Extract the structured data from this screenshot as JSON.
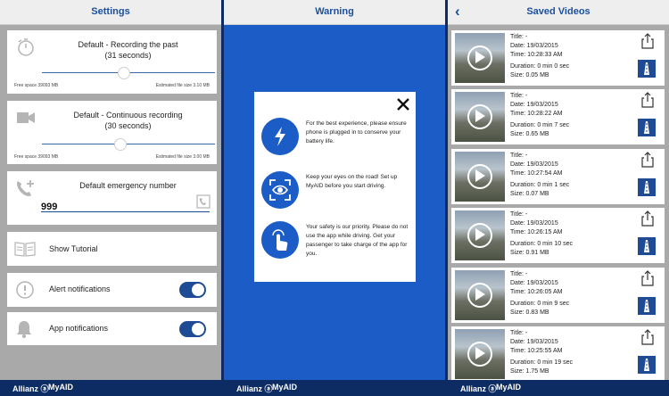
{
  "settings": {
    "title": "Settings",
    "recording_past": {
      "title": "Default - Recording the past",
      "sub": "(31 seconds)",
      "free": "Free space 39093 MB",
      "size": "Estimated file size 3.10 MB",
      "level": 0.47
    },
    "continuous": {
      "title": "Default - Continuous recording",
      "sub": "(30 seconds)",
      "free": "Free space 39093 MB",
      "size": "Estimated file size 3.00 MB",
      "level": 0.45
    },
    "emergency": {
      "title": "Default emergency number",
      "value": "999"
    },
    "tutorial": "Show Tutorial",
    "alert": "Alert notifications",
    "app": "App notifications"
  },
  "warning": {
    "title": "Warning",
    "items": [
      "For the best experience, please ensure phone is plugged in to conserve your battery life.",
      "Keep your eyes on the road! Set up MyAID before you start driving.",
      "Your safety is our priority. Please do not use the app while driving. Get your passenger to take charge of the app for you."
    ]
  },
  "videos": {
    "title": "Saved Videos",
    "list": [
      {
        "title": "Title:  -",
        "date": "Date: 19/03/2015",
        "time": "Time: 10:28:33 AM",
        "duration": "Duration: 0 min 0 sec",
        "size": "Size: 0.05 MB"
      },
      {
        "title": "Title:  -",
        "date": "Date: 19/03/2015",
        "time": "Time: 10:28:22 AM",
        "duration": "Duration: 0 min 7 sec",
        "size": "Size: 0.65 MB"
      },
      {
        "title": "Title:  -",
        "date": "Date: 19/03/2015",
        "time": "Time: 10:27:54 AM",
        "duration": "Duration: 0 min 1 sec",
        "size": "Size: 0.07 MB"
      },
      {
        "title": "Title:  -",
        "date": "Date: 19/03/2015",
        "time": "Time: 10:26:15 AM",
        "duration": "Duration: 0 min 10 sec",
        "size": "Size: 0.91 MB"
      },
      {
        "title": "Title:  -",
        "date": "Date: 19/03/2015",
        "time": "Time: 10:26:05 AM",
        "duration": "Duration: 0 min 9 sec",
        "size": "Size: 0.83 MB"
      },
      {
        "title": "Title:  -",
        "date": "Date: 19/03/2015",
        "time": "Time: 10:25:55 AM",
        "duration": "Duration: 0 min 19 sec",
        "size": "Size: 1.75 MB"
      }
    ]
  },
  "footer": {
    "brand": "Allianz ⓐ",
    "app": "MyAID"
  },
  "icons": {
    "back": "chevron-left-icon",
    "close": "close-icon",
    "bolt": "lightning-icon",
    "eye": "eye-icon",
    "touch": "touch-icon",
    "share": "share-icon"
  },
  "colors": {
    "accent": "#1b4f9e",
    "warning_bg": "#1b5cc6",
    "footer": "#0d2c63",
    "toggle": "#1e4b93"
  }
}
